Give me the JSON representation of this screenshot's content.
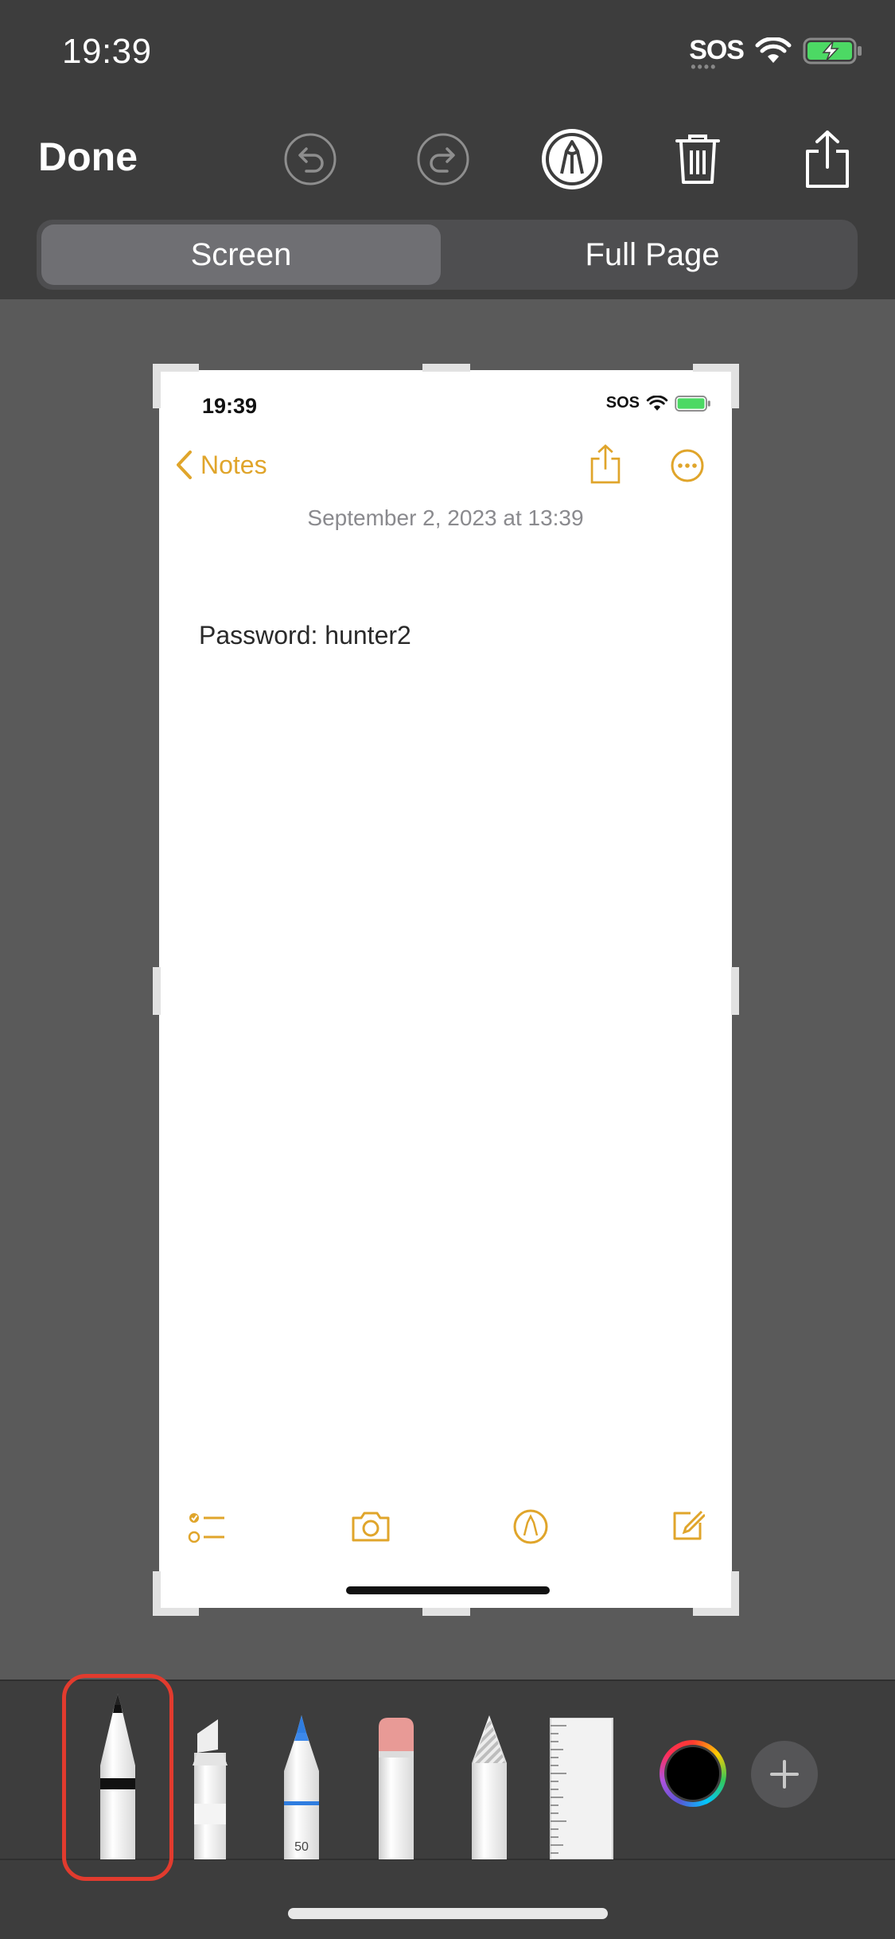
{
  "status_bar": {
    "time": "19:39",
    "carrier": "SOS"
  },
  "toolbar": {
    "done_label": "Done",
    "icons": [
      "undo-icon",
      "redo-icon",
      "markup-pen-icon",
      "trash-icon",
      "share-icon"
    ]
  },
  "segment": {
    "options": [
      "Screen",
      "Full Page"
    ],
    "selected": "Screen"
  },
  "preview": {
    "status_time": "19:39",
    "status_carrier": "SOS",
    "back_label": "Notes",
    "date": "September 2, 2023 at 13:39",
    "body": "Password: hunter2",
    "bottom_icons": [
      "checklist-icon",
      "camera-icon",
      "markup-icon",
      "compose-icon"
    ],
    "accent_color": "#e0a52b"
  },
  "tools": {
    "items": [
      "pen",
      "marker",
      "pencil",
      "eraser",
      "lasso",
      "ruler"
    ],
    "selected": "pen",
    "pencil_width": "50",
    "current_color": "#000000"
  }
}
